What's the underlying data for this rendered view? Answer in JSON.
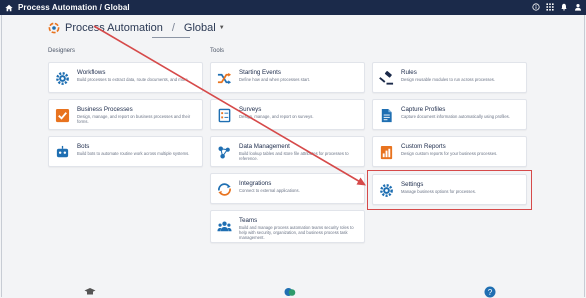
{
  "topbar": {
    "title": "Process Automation / Global",
    "icons": [
      "info-icon",
      "grid-icon",
      "bell-icon",
      "user-icon"
    ]
  },
  "header": {
    "title": "Process Automation",
    "separator": "/",
    "scope": "Global"
  },
  "sections": {
    "designers": "Designers",
    "tools": "Tools"
  },
  "cards": {
    "workflows": {
      "title": "Workflows",
      "desc": "Build processes to extract data, route documents, and more."
    },
    "business_processes": {
      "title": "Business Processes",
      "desc": "Design, manage, and report on business processes and their forms."
    },
    "bots": {
      "title": "Bots",
      "desc": "Build bots to automate routine work across multiple systems."
    },
    "starting_events": {
      "title": "Starting Events",
      "desc": "Define how and when processes start."
    },
    "surveys": {
      "title": "Surveys",
      "desc": "Design, manage, and report on surveys."
    },
    "data_management": {
      "title": "Data Management",
      "desc": "Build lookup tables and store file attributes for processes to reference."
    },
    "integrations": {
      "title": "Integrations",
      "desc": "Connect to external applications."
    },
    "teams": {
      "title": "Teams",
      "desc": "Build and manage process automation teams security roles to help with security, organization, and business process task management."
    },
    "rules": {
      "title": "Rules",
      "desc": "Design reusable modules to run across processes."
    },
    "capture_profiles": {
      "title": "Capture Profiles",
      "desc": "Capture document information automatically using profiles."
    },
    "custom_reports": {
      "title": "Custom Reports",
      "desc": "Design custom reports for your business processes."
    },
    "settings": {
      "title": "Settings",
      "desc": "Manage business options for processes."
    }
  },
  "colors": {
    "topbar": "#1b2a4a",
    "highlight": "#d64a4a",
    "blue_icon": "#1f6fb2",
    "orange_icon": "#e8731f"
  }
}
